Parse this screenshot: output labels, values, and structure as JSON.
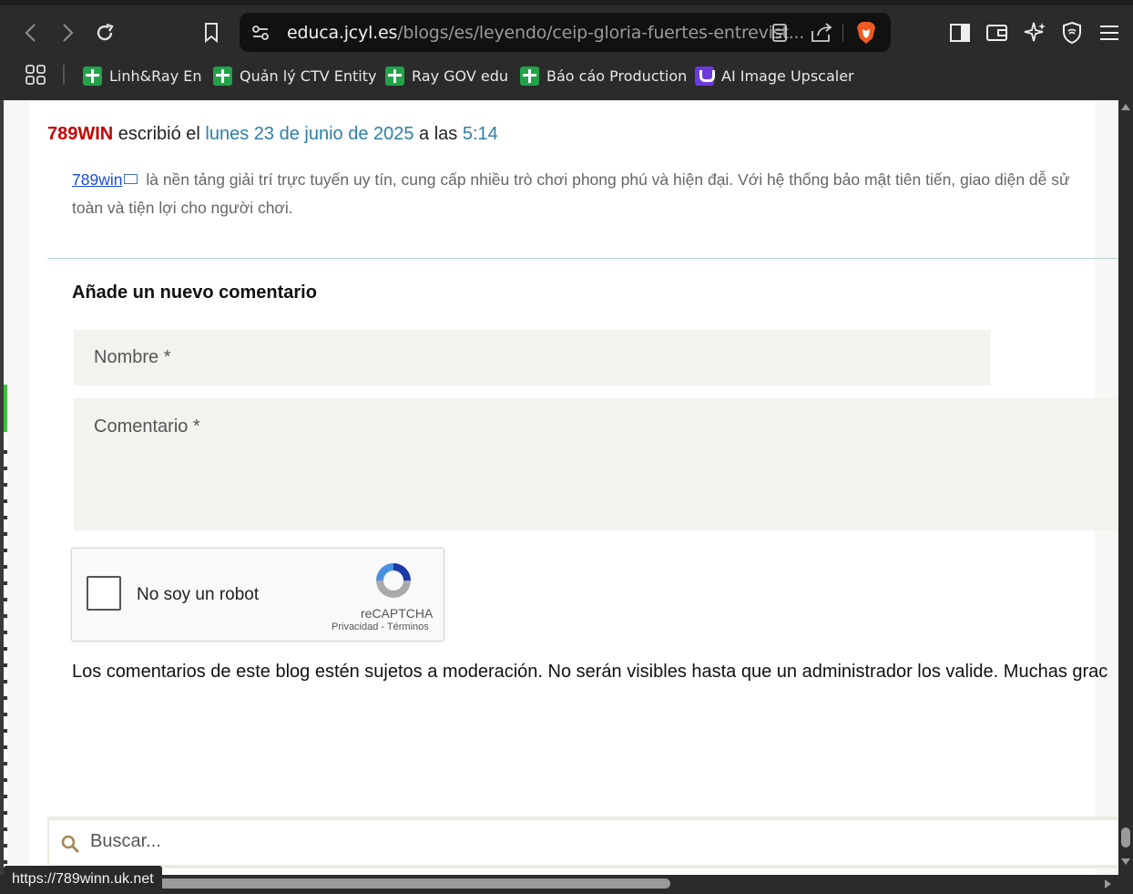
{
  "browser": {
    "url_host": "educa.jcyl.es",
    "url_path": "/blogs/es/leyendo/ceip-gloria-fuertes-entrevist...",
    "bookmarks": [
      {
        "label": "Linh&Ray En",
        "icon": "sheets-icon"
      },
      {
        "label": "Quản lý CTV Entity",
        "icon": "sheets-icon"
      },
      {
        "label": "Ray GOV edu",
        "icon": "sheets-icon"
      },
      {
        "label": "Báo cáo Production",
        "icon": "sheets-icon"
      },
      {
        "label": "AI Image Upscaler",
        "icon": "upscaler-icon"
      }
    ],
    "status_url": "https://789winn.uk.net"
  },
  "comment": {
    "author": "789WIN",
    "wrote": " escribió el ",
    "date": "lunes 23 de junio de 2025",
    "at": " a las ",
    "time": "5:14",
    "link_text": "789win",
    "text_line1": " là nền tảng giải trí trực tuyến uy tín, cung cấp nhiều trò chơi phong phú và hiện đại. Với hệ thống bảo mật tiên tiến, giao diện dễ sử",
    "text_line2": "toàn và tiện lợi cho người chơi."
  },
  "form": {
    "title": "Añade un nuevo comentario",
    "name_placeholder": "Nombre *",
    "comment_placeholder": "Comentario *",
    "captcha_label": "No soy un robot",
    "captcha_brand": "reCAPTCHA",
    "captcha_links": "Privacidad - Términos",
    "moderation_note": "Los comentarios de este blog estén sujetos a moderación. No serán visibles hasta que un administrador los valide. Muchas grac"
  },
  "search": {
    "placeholder": "Buscar..."
  },
  "colors": {
    "author": "#c60000",
    "link": "#2f7ea6",
    "brave": "#f05a22"
  }
}
